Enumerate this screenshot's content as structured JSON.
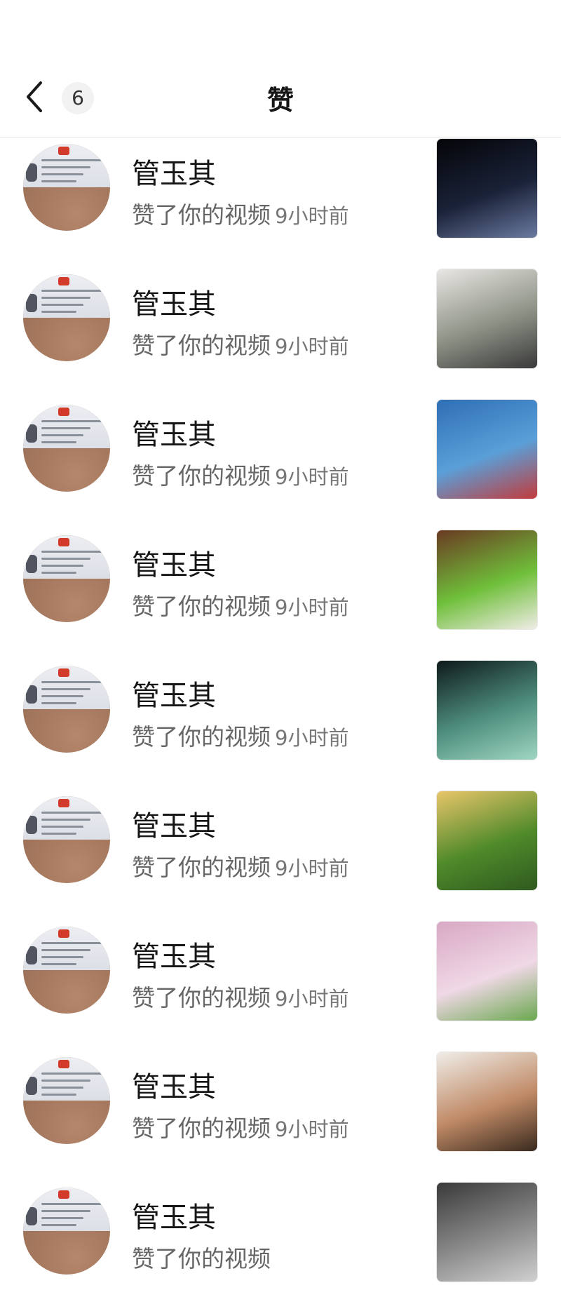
{
  "header": {
    "title": "赞",
    "count": "6",
    "back_icon": "chevron-left-icon"
  },
  "likes": [
    {
      "name": "管玉其",
      "action": "赞了你的视频",
      "time": "9小时前",
      "thumbnail": "night-city-thumbnail",
      "thumb_colors": [
        "#050508",
        "#1a2238",
        "#6a7aa0"
      ]
    },
    {
      "name": "管玉其",
      "action": "赞了你的视频",
      "time": "9小时前",
      "thumbnail": "woman-office-thumbnail",
      "thumb_colors": [
        "#e9e6e3",
        "#8d9286",
        "#3a3a3a"
      ]
    },
    {
      "name": "管玉其",
      "action": "赞了你的视频",
      "time": "9小时前",
      "thumbnail": "ethnic-costume-lake-thumbnail",
      "thumb_colors": [
        "#2f6fb5",
        "#5a9fd8",
        "#c23b3b"
      ]
    },
    {
      "name": "管玉其",
      "action": "赞了你的视频",
      "time": "9小时前",
      "thumbnail": "food-plate-thumbnail",
      "thumb_colors": [
        "#6a3a22",
        "#6fbf3a",
        "#f0ece6"
      ]
    },
    {
      "name": "管玉其",
      "action": "赞了你的视频",
      "time": "9小时前",
      "thumbnail": "green-face-thumbnail",
      "thumb_colors": [
        "#0e1a1a",
        "#4f8f7e",
        "#9fd6c2"
      ]
    },
    {
      "name": "管玉其",
      "action": "赞了你的视频",
      "time": "9小时前",
      "thumbnail": "bridge-reflection-thumbnail",
      "thumb_colors": [
        "#e9c56a",
        "#4f8a2a",
        "#2f5a1f"
      ]
    },
    {
      "name": "管玉其",
      "action": "赞了你的视频",
      "time": "9小时前",
      "thumbnail": "hanfu-blossoms-thumbnail",
      "thumb_colors": [
        "#d8a8c4",
        "#f0d8e6",
        "#6aa84f"
      ]
    },
    {
      "name": "管玉其",
      "action": "赞了你的视频",
      "time": "9小时前",
      "thumbnail": "woman-portrait-thumbnail",
      "thumb_colors": [
        "#f0ede8",
        "#c08a66",
        "#3a2a1e"
      ]
    },
    {
      "name": "管玉其",
      "action": "赞了你的视频",
      "time": "",
      "thumbnail": "street-thumbnail",
      "thumb_colors": [
        "#3a3a3a",
        "#8a8a8a",
        "#d0d0d0"
      ]
    }
  ]
}
